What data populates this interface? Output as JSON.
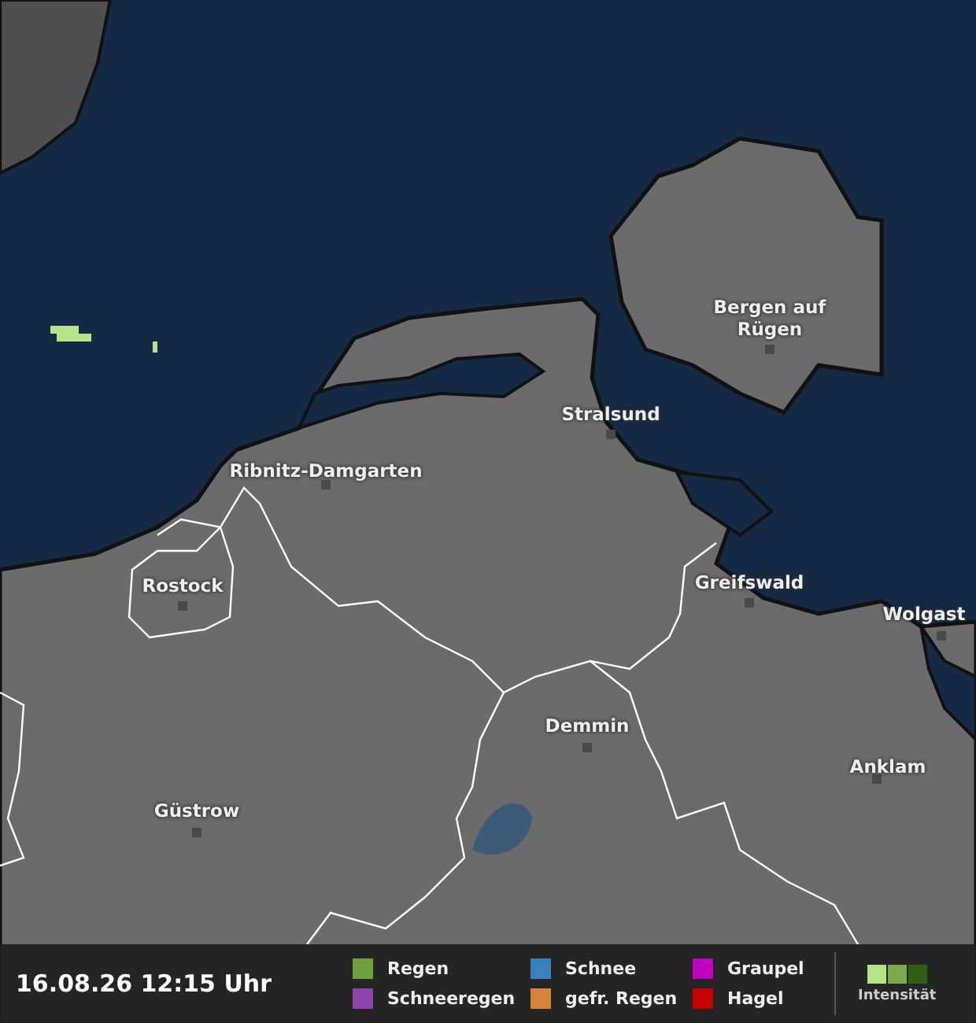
{
  "map": {
    "cities": [
      {
        "name": "Bergen auf Rügen"
      },
      {
        "name": "Stralsund"
      },
      {
        "name": "Ribnitz-Damgarten"
      },
      {
        "name": "Rostock"
      },
      {
        "name": "Greifswald"
      },
      {
        "name": "Wolgast"
      },
      {
        "name": "Demmin"
      },
      {
        "name": "Anklam"
      },
      {
        "name": "Güstrow"
      }
    ]
  },
  "status_bar": {
    "timestamp": "16.08.26 12:15 Uhr",
    "legend": [
      {
        "label": "Regen",
        "color": "#6f9e3c"
      },
      {
        "label": "Schnee",
        "color": "#3a80b9"
      },
      {
        "label": "Graupel",
        "color": "#c000c0"
      },
      {
        "label": "Schneeregen",
        "color": "#8e44ad"
      },
      {
        "label": "gefr. Regen",
        "color": "#d9823b"
      },
      {
        "label": "Hagel",
        "color": "#c80000"
      }
    ],
    "intensity": {
      "label": "Intensität",
      "levels": [
        {
          "color": "#b5e38a"
        },
        {
          "color": "#7aa84a"
        },
        {
          "color": "#2f5f12"
        }
      ]
    }
  }
}
